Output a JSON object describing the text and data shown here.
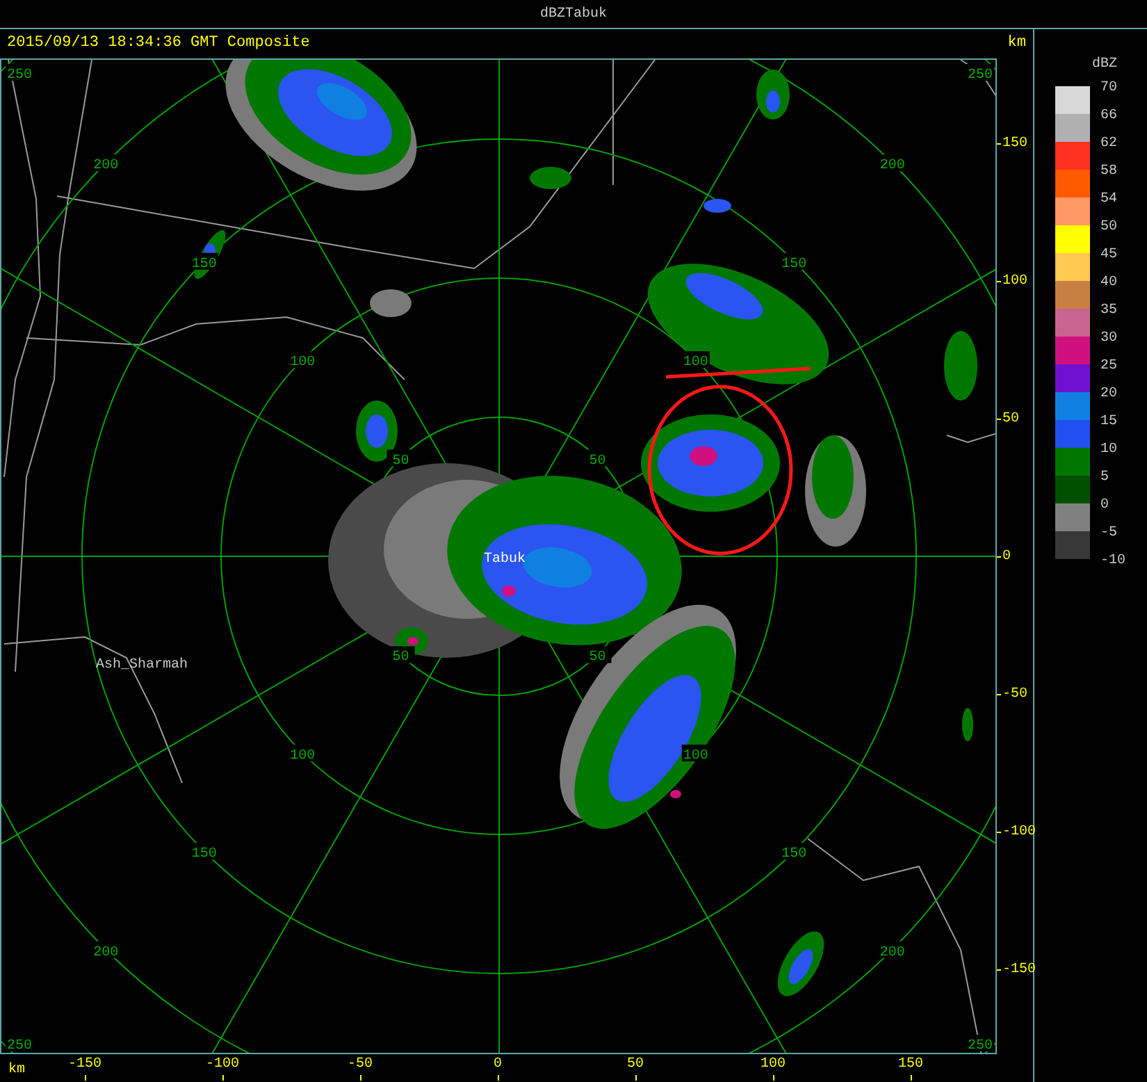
{
  "window": {
    "title": "dBZTabuk"
  },
  "header": {
    "timestamp": "2015/09/13 18:34:36 GMT Composite",
    "unit": "km"
  },
  "map": {
    "places": [
      "Tabuk",
      "Ash_Sharmah"
    ],
    "ring_labels": [
      [
        "50",
        "100",
        "150",
        "200",
        "250"
      ],
      [
        "50",
        "100",
        "150",
        "200",
        "250"
      ],
      [
        "50",
        "100",
        "150",
        "200",
        "250"
      ],
      [
        "50",
        "100",
        "150",
        "200",
        "250"
      ]
    ]
  },
  "y_axis": {
    "ticks": [
      "150",
      "100",
      "50",
      "0",
      "-50",
      "-100",
      "-150"
    ]
  },
  "x_axis": {
    "unit": "km",
    "ticks": [
      "-150",
      "-100",
      "-50",
      "0",
      "50",
      "100",
      "150"
    ]
  },
  "legend": {
    "title": "dBZ",
    "levels": [
      {
        "label": "70",
        "color": "#d8d8d8"
      },
      {
        "label": "66",
        "color": "#b0b0b0"
      },
      {
        "label": "62",
        "color": "#ff3020"
      },
      {
        "label": "58",
        "color": "#ff5a00"
      },
      {
        "label": "54",
        "color": "#ff9966"
      },
      {
        "label": "50",
        "color": "#ffff00"
      },
      {
        "label": "45",
        "color": "#ffc850"
      },
      {
        "label": "40",
        "color": "#c88040"
      },
      {
        "label": "35",
        "color": "#c86490"
      },
      {
        "label": "30",
        "color": "#d01080"
      },
      {
        "label": "25",
        "color": "#7010d0"
      },
      {
        "label": "20",
        "color": "#1080e0"
      },
      {
        "label": "15",
        "color": "#2050f0"
      },
      {
        "label": "10",
        "color": "#007800"
      },
      {
        "label": "5",
        "color": "#005000"
      },
      {
        "label": "0",
        "color": "#808080"
      },
      {
        "label": "-5",
        "color": "#383838"
      }
    ],
    "bottom_label": "-10"
  }
}
